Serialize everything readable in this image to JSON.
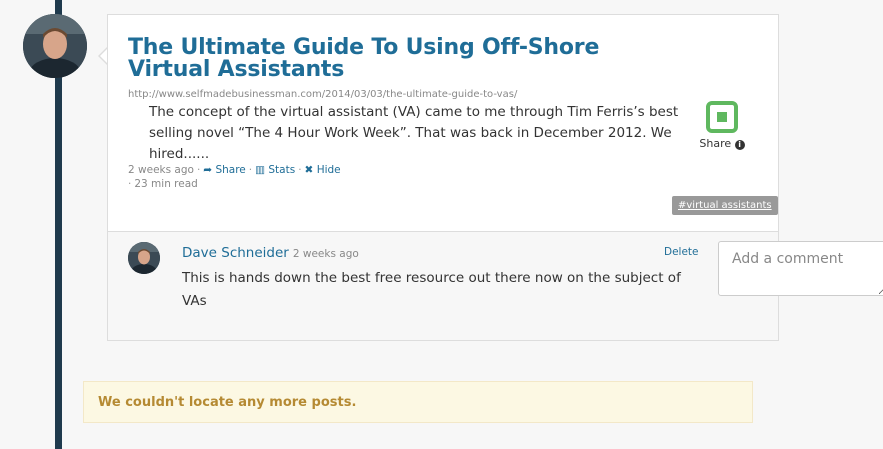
{
  "post": {
    "title": "The Ultimate Guide To Using Off-Shore Virtual Assistants",
    "url": "http://www.selfmadebusinessman.com/2014/03/03/the-ultimate-guide-to-vas/",
    "excerpt": "The concept of the virtual assistant (VA) came to me through Tim Ferris’s best selling novel “The 4 Hour Work Week”. That was back in December 2012. We hired......",
    "meta": {
      "time": "2 weeks ago",
      "share": "Share",
      "stats": "Stats",
      "hide": "Hide",
      "read_time": "23 min read"
    },
    "share_box_label": "Share",
    "tag": "#virtual assistants"
  },
  "comment": {
    "author": "Dave Schneider",
    "time": "2 weeks ago",
    "delete": "Delete",
    "text": "This is hands down the best free resource out there now on the subject of VAs"
  },
  "add_comment": {
    "placeholder": "Add a comment"
  },
  "no_more_posts": "We couldn't locate any more posts.",
  "colors": {
    "timeline": "#1f3a4d",
    "title": "#1f6d97",
    "share_green": "#5fb85f",
    "notice_bg": "#fcf8e3",
    "notice_text": "#b58a33"
  }
}
